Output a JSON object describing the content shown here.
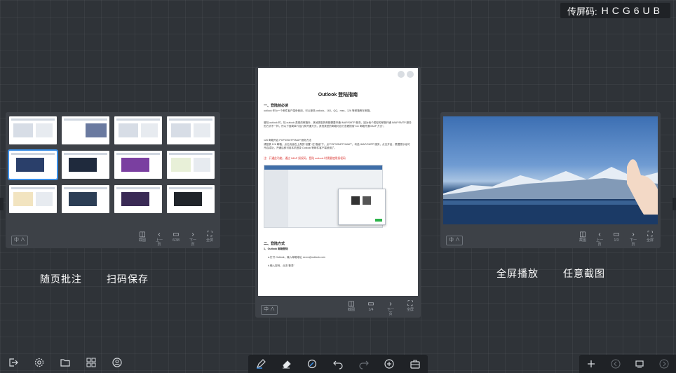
{
  "cast_code": {
    "label": "传屏码:",
    "value": "HCG6UB"
  },
  "left_panel": {
    "caption_annotate": "随页批注",
    "caption_save": "扫码保存",
    "tag": "中 ∧",
    "tools": [
      "截图",
      "上一页",
      "6/38",
      "下一页",
      "全屏"
    ]
  },
  "doc_panel": {
    "title": "Outlook 登陆指南",
    "section1": "一、登陆前必读",
    "para1": "outlook 作为一个邮件客户端来使用，可以登陆 outlook、163、QQ、msn、126 等邮箱等在邮箱。",
    "para2": "登陆 outlook 时，除 outlook 类型的邮箱外，其他类型的邮箱需要开通 IMAP/SMTP 服务，因为每个类型的邮箱开通 IMAP/SMTP 服务的方式不一样，所以下面简单介绍几种开通方式，其他类型的邮箱可自行查看搜索“xxx 邮箱开通 IMAP 方式”。",
    "para3": "126 邮箱开启 POP3/SMTP/IMAP 服务方法",
    "para4": "请登录 126 邮箱，点击页面右上角的“设置”-在“高级”下，点“POP3/SMTP/IMAP”，勾选 IMAP/SMTP 服务，点击开启，根据提示经可开启成功，开通后即可用本机登录 Outlook 等邮件客户端使用了。",
    "red_note": "注：开通此功能，通过 IMAP 授权码，登陆 outlook 时需要使用授权码",
    "section2": "二、登陆方式",
    "sub1": "1、Outlook 邮箱登陆",
    "step1": "a.打开 Outlook，输入邮箱地址 xxxxx@outlook.com",
    "step2": "b.输入密码，点击“登录”",
    "tag": "中 ∧",
    "tools": [
      "截图",
      "1/4",
      "下一页",
      "全屏"
    ]
  },
  "img_panel": {
    "caption_fullscreen": "全屏播放",
    "caption_screenshot": "任意截图",
    "tag": "中 ∧",
    "tools": [
      "截图",
      "上一页",
      "1/3",
      "下一页",
      "全屏"
    ]
  },
  "bottom_left_icons": [
    "exit-icon",
    "settings-icon",
    "folder-icon",
    "apps-icon",
    "user-icon"
  ],
  "bottom_center_icons": [
    "pen-icon",
    "eraser-icon",
    "highlighter-icon",
    "undo-icon",
    "redo-icon",
    "add-icon",
    "toolbox-icon"
  ],
  "bottom_right_icons": [
    "add-page-icon",
    "prev-page-icon",
    "pages-icon",
    "next-page-icon"
  ]
}
